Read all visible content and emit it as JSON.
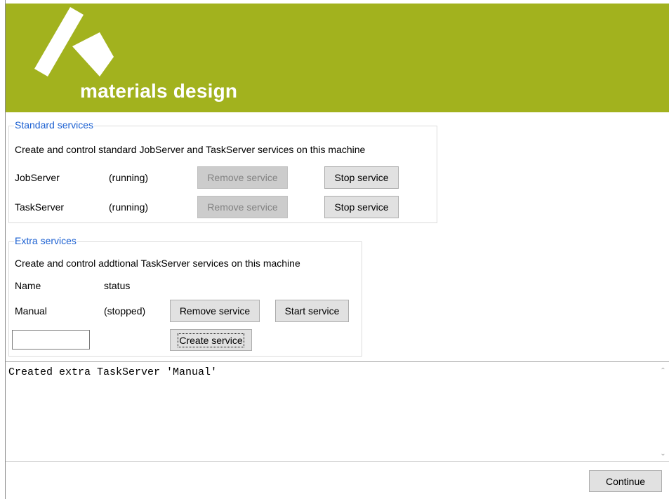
{
  "brand": {
    "name": "materials design"
  },
  "standard": {
    "legend": "Standard services",
    "description": "Create and control standard JobServer and TaskServer services on this machine",
    "rows": [
      {
        "name": "JobServer",
        "status": "(running)",
        "remove_label": "Remove service",
        "action_label": "Stop service"
      },
      {
        "name": "TaskServer",
        "status": "(running)",
        "remove_label": "Remove service",
        "action_label": "Stop service"
      }
    ]
  },
  "extra": {
    "legend": "Extra services",
    "description": "Create and control addtional TaskServer services on this machine",
    "header": {
      "name": "Name",
      "status": "status"
    },
    "rows": [
      {
        "name": "Manual",
        "status": "(stopped)",
        "remove_label": "Remove service",
        "action_label": "Start service"
      }
    ],
    "new_name_value": "",
    "create_label": "Create service"
  },
  "log": {
    "text": "Created extra TaskServer 'Manual'"
  },
  "footer": {
    "continue_label": "Continue"
  },
  "colors": {
    "banner": "#a2b21e",
    "legend": "#1a5fd1"
  }
}
